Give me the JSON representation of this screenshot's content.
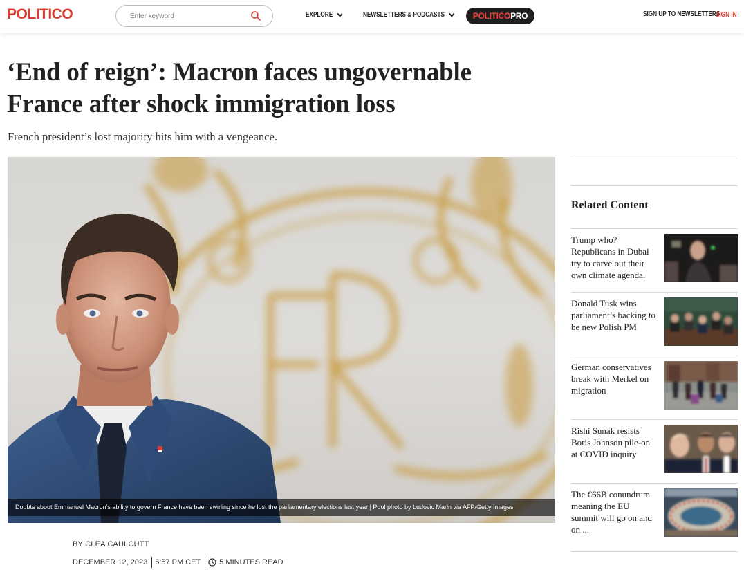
{
  "header": {
    "logo": "POLITICO",
    "search_placeholder": "Enter keyword",
    "nav": [
      {
        "label": "EXPLORE"
      },
      {
        "label": "NEWSLETTERS & PODCASTS"
      }
    ],
    "pro_label_red": "POLITICO",
    "pro_label_white": "PRO",
    "signup": "SIGN UP TO NEWSLETTERS",
    "signin": "SIGN IN"
  },
  "article": {
    "headline": "‘End of reign’: Macron faces ungovernable France after shock immigration loss",
    "dek": "French president’s lost majority hits him with a vengeance.",
    "caption": "Doubts about Emmanuel Macron’s ability to govern France have been swirling since he lost the parliamentary elections last year | Pool photo by Ludovic Marin via AFP/Getty Images",
    "byline": "BY CLEA CAULCUTT",
    "date": "DECEMBER 12, 2023",
    "time": "6:57 PM CET",
    "read_time": "5 MINUTES READ"
  },
  "sidebar": {
    "title": "Related Content",
    "items": [
      {
        "text": "Trump who? Republicans in Dubai try to carve out their own climate agenda."
      },
      {
        "text": "Donald Tusk wins parliament’s backing to be new Polish PM"
      },
      {
        "text": "German conservatives break with Merkel on migration"
      },
      {
        "text": "Rishi Sunak resists Boris Johnson pile-on at COVID inquiry"
      },
      {
        "text": "The €66B conundrum meaning the EU summit will go on and on ..."
      }
    ]
  },
  "colors": {
    "brand_red": "#dc3a2f",
    "pro_background": "#1e1e1e",
    "text": "#222222"
  }
}
